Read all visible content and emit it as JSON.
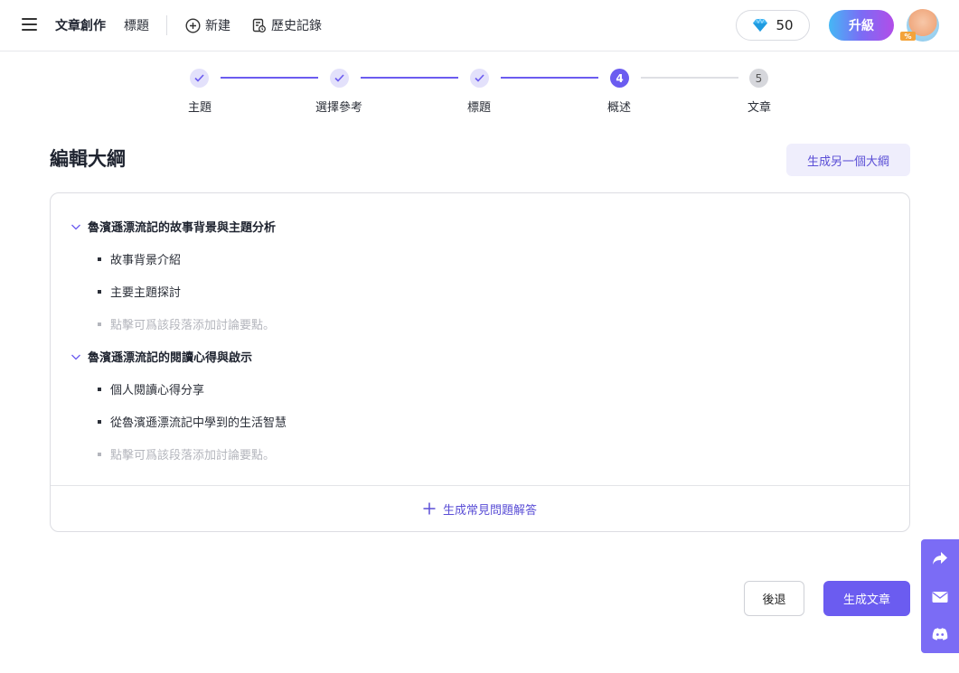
{
  "header": {
    "title": "文章創作",
    "subtitle": "標題",
    "new_label": "新建",
    "history_label": "歷史記錄",
    "gems": "50",
    "upgrade_label": "升級"
  },
  "stepper": {
    "steps": [
      {
        "label": "主題",
        "state": "done",
        "number": ""
      },
      {
        "label": "選擇參考",
        "state": "done",
        "number": ""
      },
      {
        "label": "標題",
        "state": "done",
        "number": ""
      },
      {
        "label": "概述",
        "state": "active",
        "number": "4"
      },
      {
        "label": "文章",
        "state": "pending",
        "number": "5"
      }
    ]
  },
  "main": {
    "title": "編輯大綱",
    "regenerate_label": "生成另一個大綱",
    "sections": [
      {
        "heading": "魯濱遜漂流記的故事背景與主題分析",
        "points": [
          "故事背景介紹",
          "主要主題探討"
        ],
        "placeholder": "點擊可爲該段落添加討論要點。"
      },
      {
        "heading": "魯濱遜漂流記的閱讀心得與啟示",
        "points": [
          "個人閱讀心得分享",
          "從魯濱遜漂流記中學到的生活智慧"
        ],
        "placeholder": "點擊可爲該段落添加討論要點。"
      }
    ],
    "faq_label": "生成常見問題解答"
  },
  "footer": {
    "back_label": "後退",
    "generate_label": "生成文章"
  },
  "colors": {
    "accent": "#6b5cf0",
    "accent_light": "#efeefc",
    "side_bar": "#7b6cf5"
  },
  "icons": {
    "menu": "hamburger-icon",
    "new": "plus-circle-icon",
    "history": "history-doc-icon",
    "gem": "diamond-icon",
    "chevron": "chevron-down-icon",
    "faq": "plus-icon",
    "share": "share-icon",
    "mail": "mail-icon",
    "discord": "discord-icon"
  }
}
